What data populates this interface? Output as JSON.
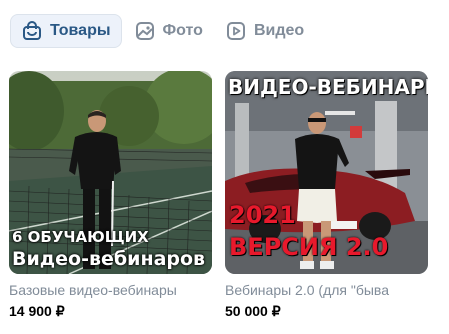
{
  "tabs": [
    {
      "label": "Товары",
      "icon": "shopping-bag-icon",
      "active": true
    },
    {
      "label": "Фото",
      "icon": "image-icon",
      "active": false
    },
    {
      "label": "Видео",
      "icon": "video-play-icon",
      "active": false
    }
  ],
  "products": [
    {
      "title": "Базовые видео-вебинары",
      "price": "14 900 ₽",
      "overlay_line1": "6 ОБУЧАЮЩИХ",
      "overlay_line2": "Видео-вебинаров"
    },
    {
      "title": "Вебинары 2.0 (для \"быва",
      "price": "50 000 ₽",
      "overlay_top": "ВИДЕО-ВЕБИНАРЫ",
      "overlay_year": "2021",
      "overlay_version": "ВЕРСИЯ 2.0"
    }
  ],
  "colors": {
    "accent": "#2a5885",
    "muted": "#818c99",
    "active_tab_bg": "#edf2fa",
    "promo_red": "#e8192c"
  }
}
